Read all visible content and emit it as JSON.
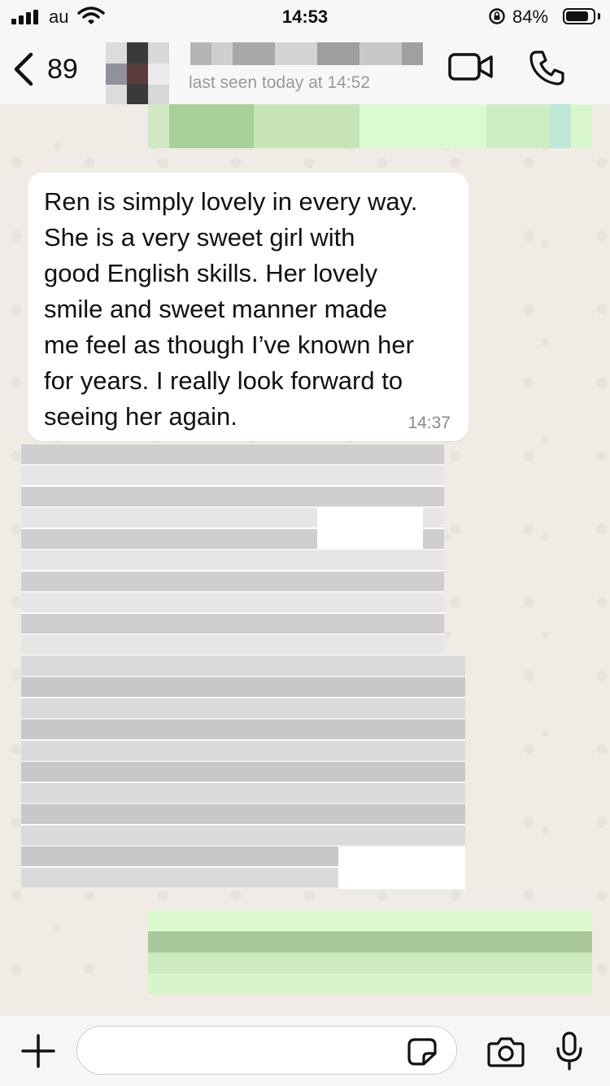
{
  "status_bar": {
    "carrier": "au",
    "time": "14:53",
    "battery_percent": "84%",
    "battery_level": 0.84
  },
  "header": {
    "back_count": "89",
    "last_seen": "last seen today at 14:52",
    "icons": [
      "chevron-left-icon",
      "video-camera-icon",
      "phone-icon"
    ]
  },
  "messages": [
    {
      "direction": "received",
      "text": "Ren is simply lovely in every way.\nShe is a very sweet girl with\ngood English skills. Her lovely\nsmile and sweet manner made\nme feel as though I’ve known her\nfor years. I really look forward to\nseeing her again.",
      "time": "14:37"
    }
  ],
  "input_bar": {
    "placeholder": "",
    "icons": [
      "plus-icon",
      "sticker-icon",
      "camera-icon",
      "microphone-icon"
    ]
  },
  "colors": {
    "sent_bubble": "#dcf8c6",
    "received_bubble": "#ffffff",
    "bar_background": "#f7f7f7"
  }
}
